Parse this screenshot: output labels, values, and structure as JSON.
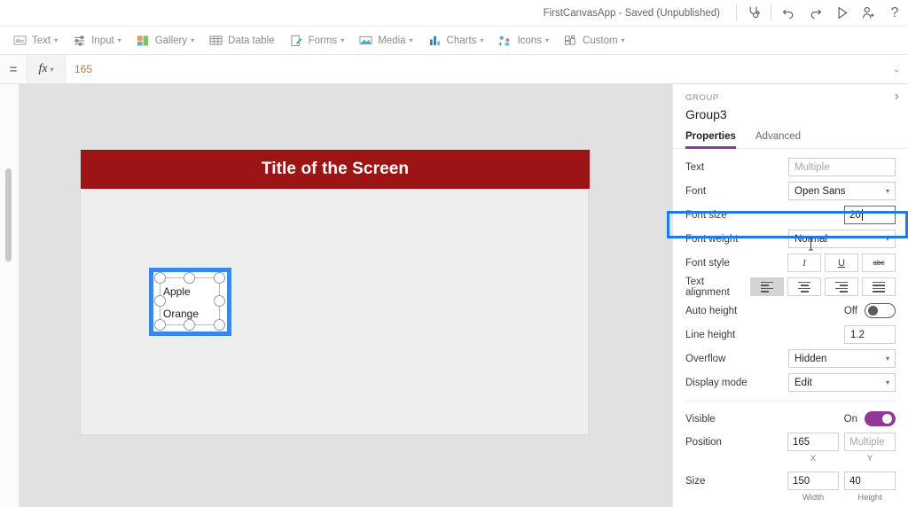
{
  "topbar": {
    "app_title": "FirstCanvasApp - Saved (Unpublished)",
    "icons": [
      {
        "name": "app-checker-icon",
        "label": "App checker"
      },
      {
        "name": "undo-icon",
        "label": "Undo"
      },
      {
        "name": "redo-icon",
        "label": "Redo"
      },
      {
        "name": "play-preview-icon",
        "label": "Preview the app"
      },
      {
        "name": "share-user-icon",
        "label": "Share"
      },
      {
        "name": "help-icon",
        "label": "?"
      }
    ]
  },
  "ribbon": {
    "items": [
      {
        "label": "Text",
        "icon": "text-abc-icon",
        "has_chevron": true
      },
      {
        "label": "Input",
        "icon": "input-sliders-icon",
        "has_chevron": true
      },
      {
        "label": "Gallery",
        "icon": "gallery-tiles-icon",
        "has_chevron": true
      },
      {
        "label": "Data table",
        "icon": "data-table-grid-icon",
        "has_chevron": false
      },
      {
        "label": "Forms",
        "icon": "forms-pencil-icon",
        "has_chevron": true
      },
      {
        "label": "Media",
        "icon": "media-image-icon",
        "has_chevron": true
      },
      {
        "label": "Charts",
        "icon": "charts-bar-icon",
        "has_chevron": true
      },
      {
        "label": "Icons",
        "icon": "icons-shapes-icon",
        "has_chevron": true
      },
      {
        "label": "Custom",
        "icon": "custom-blocks-icon",
        "has_chevron": true
      }
    ]
  },
  "formula_bar": {
    "equals_symbol": "=",
    "fx_label": "fx",
    "value": "165",
    "expand_symbol": "⌄"
  },
  "canvas": {
    "screen_title": "Title of the Screen",
    "title_bg_color": "#9c1515",
    "selection_color": "#3b86e8",
    "group_labels": [
      "Apple",
      "Orange"
    ]
  },
  "properties": {
    "kind": "GROUP",
    "name": "Group3",
    "collapse_symbol": "›",
    "tabs": [
      {
        "label": "Properties",
        "active": true
      },
      {
        "label": "Advanced",
        "active": false
      }
    ],
    "rows": {
      "text": {
        "label": "Text",
        "value": "",
        "placeholder": "Multiple"
      },
      "font": {
        "label": "Font",
        "value": "Open Sans"
      },
      "font_size": {
        "label": "Font size",
        "value": "20",
        "highlighted": true,
        "highlight_color": "#1d7aea"
      },
      "font_weight": {
        "label": "Font weight",
        "value": "Normal"
      },
      "font_style": {
        "label": "Font style",
        "buttons": [
          {
            "name": "italic-button",
            "glyph": "I"
          },
          {
            "name": "underline-button",
            "glyph": "U"
          },
          {
            "name": "strikethrough-button",
            "glyph": "abc"
          }
        ]
      },
      "text_alignment": {
        "label": "Text alignment",
        "buttons": [
          {
            "name": "align-left-button",
            "selected": true
          },
          {
            "name": "align-center-button",
            "selected": false
          },
          {
            "name": "align-right-button",
            "selected": false
          },
          {
            "name": "align-justify-button",
            "selected": false
          }
        ]
      },
      "auto_height": {
        "label": "Auto height",
        "state": "Off",
        "on": false
      },
      "line_height": {
        "label": "Line height",
        "value": "1.2"
      },
      "overflow": {
        "label": "Overflow",
        "value": "Hidden"
      },
      "display_mode": {
        "label": "Display mode",
        "value": "Edit"
      },
      "visible": {
        "label": "Visible",
        "state": "On",
        "on": true
      },
      "position": {
        "label": "Position",
        "x_value": "165",
        "x_sub": "X",
        "y_value": "",
        "y_placeholder": "Multiple",
        "y_sub": "Y"
      },
      "size": {
        "label": "Size",
        "width_value": "150",
        "width_sub": "Width",
        "height_value": "40",
        "height_sub": "Height"
      }
    }
  }
}
